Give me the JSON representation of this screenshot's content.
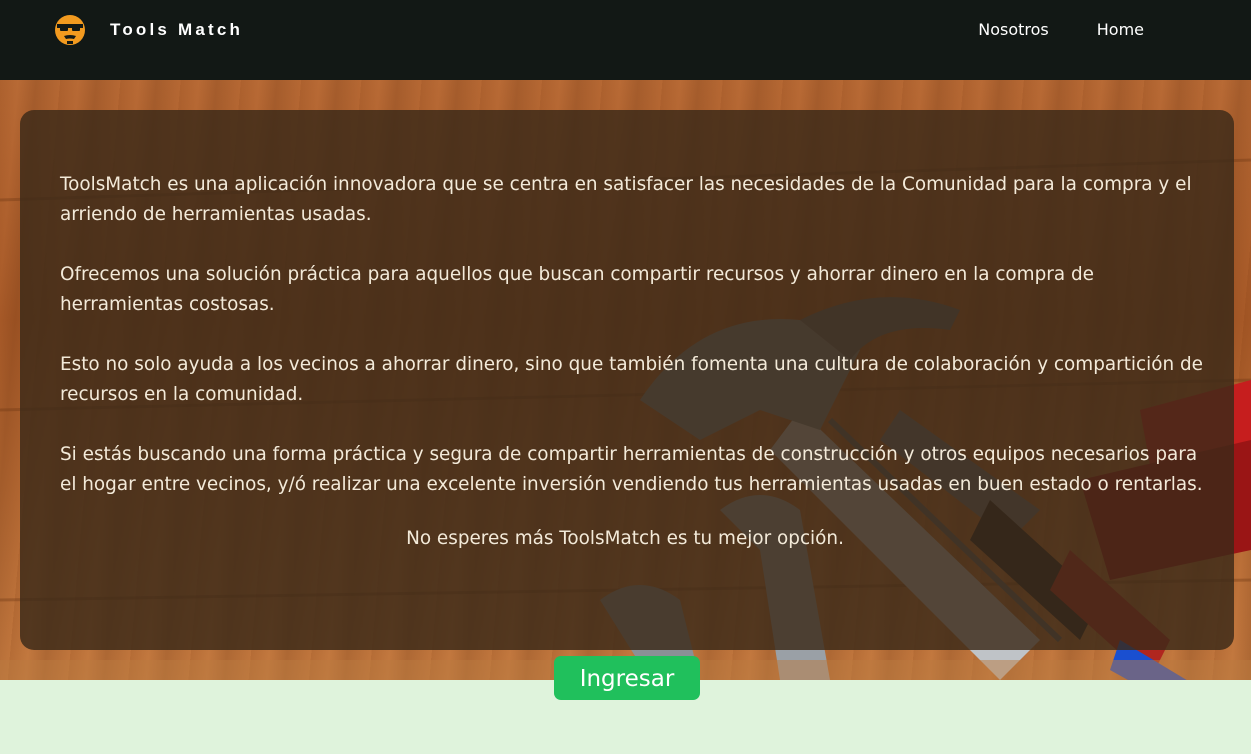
{
  "navbar": {
    "brand_name": "Tools Match",
    "logo_icon": "face-logo-icon",
    "links": [
      {
        "label": "Nosotros"
      },
      {
        "label": "Home"
      }
    ]
  },
  "hero": {
    "background_image": "tools-hammer-wrench-pliers-photo",
    "paragraphs": [
      "ToolsMatch es una aplicación innovadora que se centra en satisfacer las necesidades de la Comunidad para la compra y el arriendo de herramientas usadas.",
      "Ofrecemos una solución práctica para aquellos que buscan compartir recursos y ahorrar dinero en la compra de herramientas costosas.",
      "Esto no solo ayuda a los vecinos a ahorrar dinero, sino que también fomenta una cultura de colaboración y compartición de recursos en la comunidad.",
      "Si estás buscando una forma práctica y segura de compartir herramientas de construcción y otros equipos necesarios para el hogar entre vecinos, y/ó realizar una excelente inversión vendiendo tus herramientas usadas en buen estado o rentarlas."
    ],
    "closing": "No esperes más ToolsMatch es tu mejor opción."
  },
  "cta": {
    "label": "Ingresar"
  },
  "colors": {
    "navbar_bg": "#121815",
    "button_bg": "#20c05c",
    "page_bg": "#dff3dc",
    "logo_orange": "#f29a1f"
  }
}
